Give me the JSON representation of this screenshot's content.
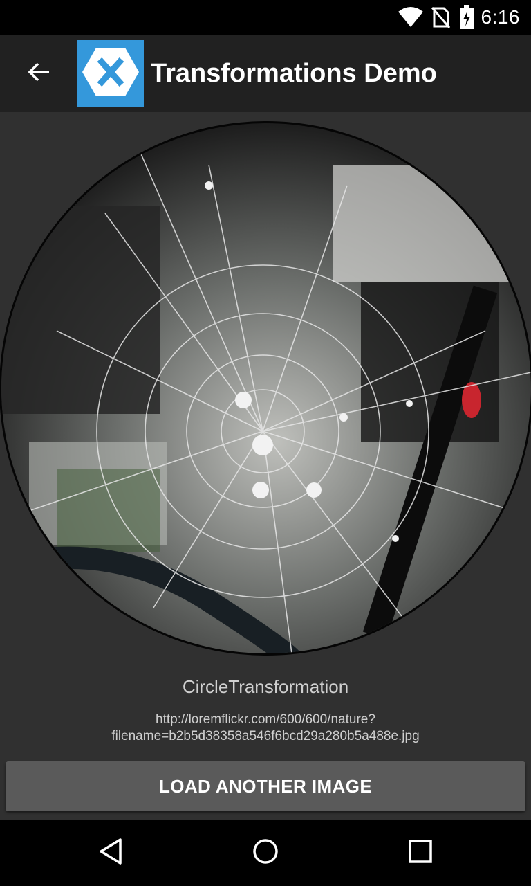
{
  "status_bar": {
    "time": "6:16",
    "icons": [
      "wifi-icon",
      "no-sim-icon",
      "battery-charging-icon"
    ]
  },
  "app_bar": {
    "title": "Transformations Demo",
    "back_icon": "arrow-back-icon",
    "logo_icon": "xamarin-logo-icon",
    "logo_color": "#3498DB",
    "background_color": "#212121"
  },
  "main": {
    "image_description_icon": "spider-web-photo",
    "transformation_label": "CircleTransformation",
    "image_url_line1": "http://loremflickr.com/600/600/nature?",
    "image_url_line2": "filename=b2b5d38358a546f6bcd29a280b5a488e.jpg",
    "load_button_label": "LOAD ANOTHER IMAGE"
  },
  "nav_bar": {
    "icons": [
      "back-triangle-icon",
      "home-circle-icon",
      "recents-square-icon"
    ]
  }
}
